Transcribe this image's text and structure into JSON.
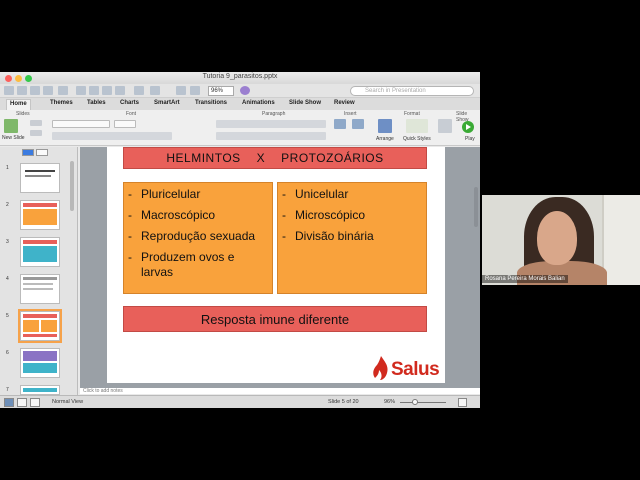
{
  "window": {
    "title": "Tutoria 9_parasitos.pptx"
  },
  "toolbar": {
    "zoom": "96%",
    "search_placeholder": "Search in Presentation"
  },
  "ribbon_tabs": [
    "Home",
    "Themes",
    "Tables",
    "Charts",
    "SmartArt",
    "Transitions",
    "Animations",
    "Slide Show",
    "Review"
  ],
  "ribbon_groups": [
    "Slides",
    "Font",
    "Paragraph",
    "Insert",
    "Format",
    "Slide Show"
  ],
  "ribbon_labels": {
    "new_slide": "New Slide",
    "arrange": "Arrange",
    "quick_styles": "Quick Styles",
    "play": "Play"
  },
  "slide": {
    "title_left": "HELMINTOS",
    "title_x": "X",
    "title_right": "PROTOZOÁRIOS",
    "left_items": [
      "Pluricelular",
      "Macroscópico",
      "Reprodução sexuada",
      "Produzem ovos e larvas"
    ],
    "right_items": [
      "Unicelular",
      "Microscópico",
      "Divisão binária"
    ],
    "response": "Resposta imune diferente",
    "logo": "Salus",
    "bullet": "-"
  },
  "notes_placeholder": "Click to add notes",
  "thumbnails": [
    "1",
    "2",
    "3",
    "4",
    "5",
    "6",
    "7"
  ],
  "status": {
    "view": "Normal View",
    "slide_info": "Slide 5 of 20",
    "zoom": "96%"
  },
  "participant": {
    "name": "Rosana Pereira Morais Balian"
  }
}
